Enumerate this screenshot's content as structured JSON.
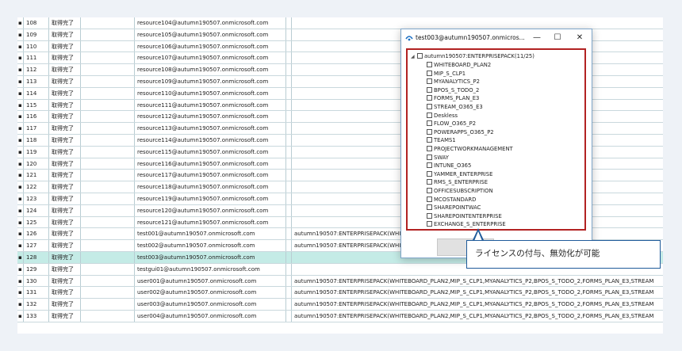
{
  "table": {
    "rows": [
      {
        "id": "108",
        "status": "取得完了",
        "email": "resource104@autumn190507.onmicrosoft.com",
        "license": ""
      },
      {
        "id": "109",
        "status": "取得完了",
        "email": "resource105@autumn190507.onmicrosoft.com",
        "license": ""
      },
      {
        "id": "110",
        "status": "取得完了",
        "email": "resource106@autumn190507.onmicrosoft.com",
        "license": ""
      },
      {
        "id": "111",
        "status": "取得完了",
        "email": "resource107@autumn190507.onmicrosoft.com",
        "license": ""
      },
      {
        "id": "112",
        "status": "取得完了",
        "email": "resource108@autumn190507.onmicrosoft.com",
        "license": ""
      },
      {
        "id": "113",
        "status": "取得完了",
        "email": "resource109@autumn190507.onmicrosoft.com",
        "license": ""
      },
      {
        "id": "114",
        "status": "取得完了",
        "email": "resource110@autumn190507.onmicrosoft.com",
        "license": ""
      },
      {
        "id": "115",
        "status": "取得完了",
        "email": "resource111@autumn190507.onmicrosoft.com",
        "license": ""
      },
      {
        "id": "116",
        "status": "取得完了",
        "email": "resource112@autumn190507.onmicrosoft.com",
        "license": ""
      },
      {
        "id": "117",
        "status": "取得完了",
        "email": "resource113@autumn190507.onmicrosoft.com",
        "license": ""
      },
      {
        "id": "118",
        "status": "取得完了",
        "email": "resource114@autumn190507.onmicrosoft.com",
        "license": ""
      },
      {
        "id": "119",
        "status": "取得完了",
        "email": "resource115@autumn190507.onmicrosoft.com",
        "license": ""
      },
      {
        "id": "120",
        "status": "取得完了",
        "email": "resource116@autumn190507.onmicrosoft.com",
        "license": ""
      },
      {
        "id": "121",
        "status": "取得完了",
        "email": "resource117@autumn190507.onmicrosoft.com",
        "license": ""
      },
      {
        "id": "122",
        "status": "取得完了",
        "email": "resource118@autumn190507.onmicrosoft.com",
        "license": ""
      },
      {
        "id": "123",
        "status": "取得完了",
        "email": "resource119@autumn190507.onmicrosoft.com",
        "license": ""
      },
      {
        "id": "124",
        "status": "取得完了",
        "email": "resource120@autumn190507.onmicrosoft.com",
        "license": ""
      },
      {
        "id": "125",
        "status": "取得完了",
        "email": "resource121@autumn190507.onmicrosoft.com",
        "license": ""
      },
      {
        "id": "126",
        "status": "取得完了",
        "email": "test001@autumn190507.onmicrosoft.com",
        "license": "autumn190507:ENTERPRISEPACK(WHI"
      },
      {
        "id": "127",
        "status": "取得完了",
        "email": "test002@autumn190507.onmicrosoft.com",
        "license": "autumn190507:ENTERPRISEPACK(WHI"
      },
      {
        "id": "128",
        "status": "取得完了",
        "email": "test003@autumn190507.onmicrosoft.com",
        "license": ""
      },
      {
        "id": "129",
        "status": "取得完了",
        "email": "testgui01@autumn190507.onmicrosoft.com",
        "license": ""
      },
      {
        "id": "130",
        "status": "取得完了",
        "email": "user001@autumn190507.onmicrosoft.com",
        "license": "autumn190507:ENTERPRISEPACK(WHITEBOARD_PLAN2,MIP_S_CLP1,MYANALYTICS_P2,BPOS_S_TODO_2,FORMS_PLAN_E3,STREAM"
      },
      {
        "id": "131",
        "status": "取得完了",
        "email": "user002@autumn190507.onmicrosoft.com",
        "license": "autumn190507:ENTERPRISEPACK(WHITEBOARD_PLAN2,MIP_S_CLP1,MYANALYTICS_P2,BPOS_S_TODO_2,FORMS_PLAN_E3,STREAM"
      },
      {
        "id": "132",
        "status": "取得完了",
        "email": "user003@autumn190507.onmicrosoft.com",
        "license": "autumn190507:ENTERPRISEPACK(WHITEBOARD_PLAN2,MIP_S_CLP1,MYANALYTICS_P2,BPOS_S_TODO_2,FORMS_PLAN_E3,STREAM"
      },
      {
        "id": "133",
        "status": "取得完了",
        "email": "user004@autumn190507.onmicrosoft.com",
        "license": "autumn190507:ENTERPRISEPACK(WHITEBOARD_PLAN2,MIP_S_CLP1,MYANALYTICS_P2,BPOS_S_TODO_2,FORMS_PLAN_E3,STREAM"
      }
    ]
  },
  "dialog": {
    "title": "test003@autumn190507.onmicros...",
    "minimize": "—",
    "maximize": "☐",
    "close": "✕",
    "root_label": "autumn190507:ENTERPRISEPACK(11/25)",
    "items": [
      "WHITEBOARD_PLAN2",
      "MIP_S_CLP1",
      "MYANALYTICS_P2",
      "BPOS_S_TODO_2",
      "FORMS_PLAN_E3",
      "STREAM_O365_E3",
      "Deskless",
      "FLOW_O365_P2",
      "POWERAPPS_O365_P2",
      "TEAMS1",
      "PROJECTWORKMANAGEMENT",
      "SWAY",
      "INTUNE_O365",
      "YAMMER_ENTERPRISE",
      "RMS_S_ENTERPRISE",
      "OFFICESUBSCRIPTION",
      "MCOSTANDARD",
      "SHAREPOINTWAC",
      "SHAREPOINTENTERPRISE",
      "EXCHANGE_S_ENTERPRISE"
    ]
  },
  "callout": {
    "text": "ライセンスの付与、無効化が可能"
  },
  "colors": {
    "row_highlight": "#c4ebe6",
    "tree_border": "#b22222",
    "callout_border": "#1f5b9a"
  }
}
